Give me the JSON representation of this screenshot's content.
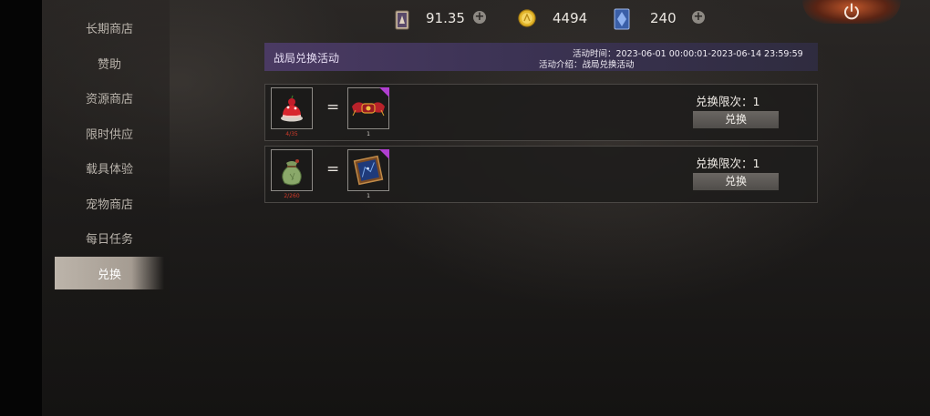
{
  "sidebar": {
    "items": [
      {
        "label": "长期商店",
        "active": false
      },
      {
        "label": "赞助",
        "active": false
      },
      {
        "label": "资源商店",
        "active": false
      },
      {
        "label": "限时供应",
        "active": false
      },
      {
        "label": "载具体验",
        "active": false
      },
      {
        "label": "宠物商店",
        "active": false
      },
      {
        "label": "每日任务",
        "active": false
      },
      {
        "label": "兑换",
        "active": true
      }
    ]
  },
  "currency": {
    "card_value": "91.35",
    "gold_value": "4494",
    "crystal_card_value": "240",
    "icons": [
      "card-icon",
      "gold-coin-icon",
      "crystal-card-icon",
      "plus-icon",
      "power-icon"
    ]
  },
  "banner": {
    "title": "战局兑换活动",
    "time": "活动时间：2023-06-01 00:00:01-2023-06-14 23:59:59",
    "intro": "活动介绍：战局兑换活动"
  },
  "exchanges": [
    {
      "cost_item_icon": "cake-icon",
      "cost_count": "4/35",
      "equals": "=",
      "reward_item_icon": "winged-emblem-icon",
      "reward_count": "1",
      "limit_label": "兑换限次：1",
      "button_label": "兑换"
    },
    {
      "cost_item_icon": "pouch-icon",
      "cost_count": "2/260",
      "equals": "=",
      "reward_item_icon": "map-frame-icon",
      "reward_count": "1",
      "limit_label": "兑换限次：1",
      "button_label": "兑换"
    }
  ],
  "colors": {
    "accent_purple": "#b03fd0",
    "cost_count_red": "#d33a2a",
    "active_tab": "#bcb4aa",
    "power_orange": "#c0562a"
  }
}
